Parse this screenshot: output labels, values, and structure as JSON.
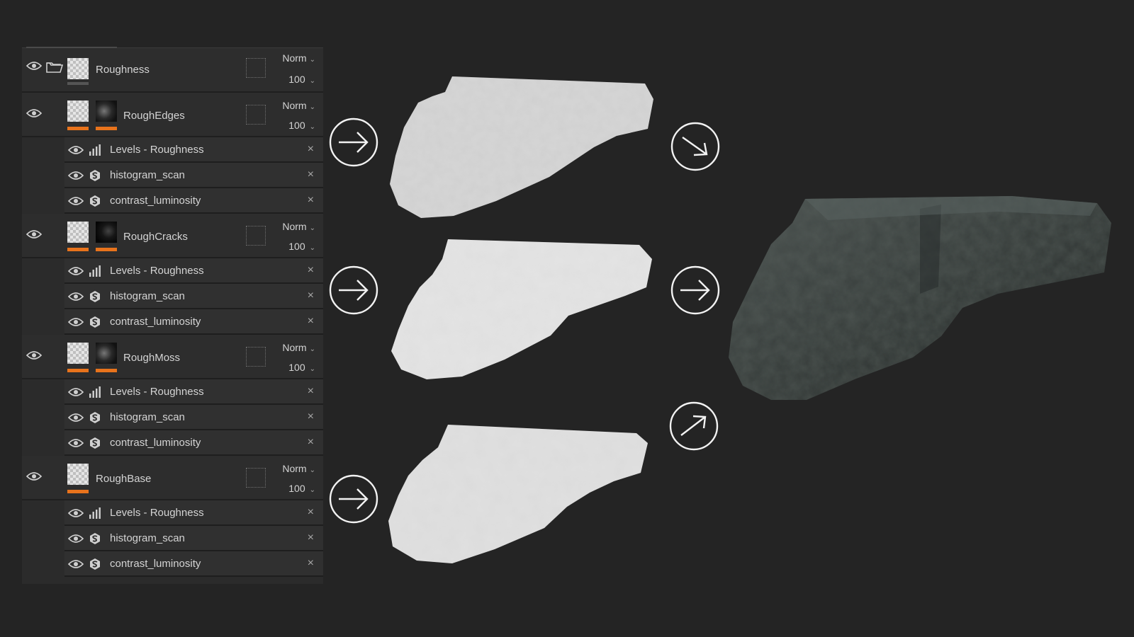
{
  "layers": {
    "roughness_group": {
      "name": "Roughness",
      "blend": "Norm",
      "opacity": "100"
    },
    "groups": [
      {
        "name": "RoughEdges",
        "blend": "Norm",
        "opacity": "100",
        "effects": [
          {
            "label": "Levels - Roughness",
            "icon": "levels-icon"
          },
          {
            "label": "histogram_scan",
            "icon": "substance-icon"
          },
          {
            "label": "contrast_luminosity",
            "icon": "substance-icon"
          }
        ]
      },
      {
        "name": "RoughCracks",
        "blend": "Norm",
        "opacity": "100",
        "effects": [
          {
            "label": "Levels - Roughness",
            "icon": "levels-icon"
          },
          {
            "label": "histogram_scan",
            "icon": "substance-icon"
          },
          {
            "label": "contrast_luminosity",
            "icon": "substance-icon"
          }
        ]
      },
      {
        "name": "RoughMoss",
        "blend": "Norm",
        "opacity": "100",
        "effects": [
          {
            "label": "Levels - Roughness",
            "icon": "levels-icon"
          },
          {
            "label": "histogram_scan",
            "icon": "substance-icon"
          },
          {
            "label": "contrast_luminosity",
            "icon": "substance-icon"
          }
        ]
      },
      {
        "name": "RoughBase",
        "blend": "Norm",
        "opacity": "100",
        "effects": [
          {
            "label": "Levels - Roughness",
            "icon": "levels-icon"
          },
          {
            "label": "histogram_scan",
            "icon": "substance-icon"
          },
          {
            "label": "contrast_luminosity",
            "icon": "substance-icon"
          }
        ]
      }
    ],
    "close_glyph": "×"
  },
  "colors": {
    "background": "#242424",
    "panel": "#2b2b2b",
    "mask_accent": "#e8731c",
    "text": "#d4d4d4"
  }
}
